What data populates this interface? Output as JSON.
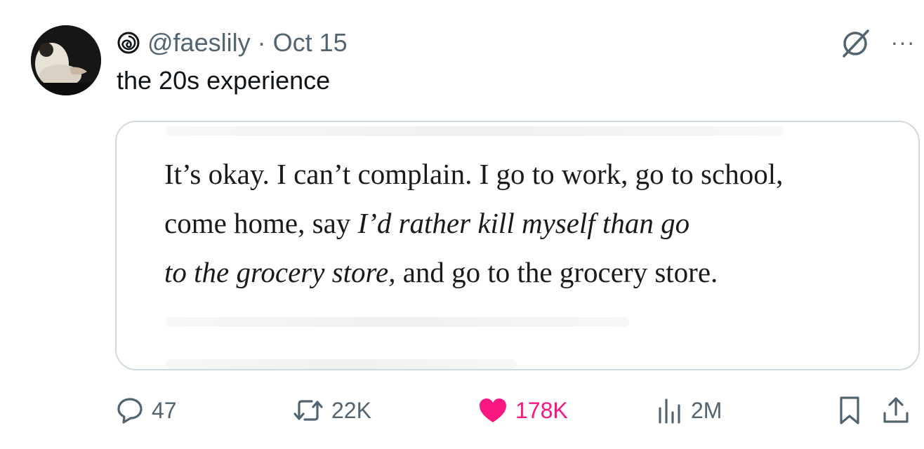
{
  "tweet": {
    "handle": "@faeslily",
    "separator": "·",
    "date": "Oct 15",
    "text": "the 20s experience"
  },
  "media": {
    "quote_line_1": "It’s okay. I can’t complain. I go to work, go to school,",
    "quote_line_2_plain": "come home, say ",
    "quote_line_2_italic": "I’d rather kill myself than go",
    "quote_line_3_italic": "to the grocery store,",
    "quote_line_3_plain": " and go to the grocery store."
  },
  "actions": {
    "replies": "47",
    "retweets": "22K",
    "likes": "178K",
    "views": "2M"
  },
  "colors": {
    "text_primary": "#0f1419",
    "text_secondary": "#536471",
    "like_pink": "#f91880",
    "border": "#cfd9de"
  },
  "icons": [
    "spiral-icon",
    "grok-icon",
    "more-icon",
    "reply-icon",
    "retweet-icon",
    "heart-icon",
    "views-icon",
    "bookmark-icon",
    "share-icon"
  ]
}
